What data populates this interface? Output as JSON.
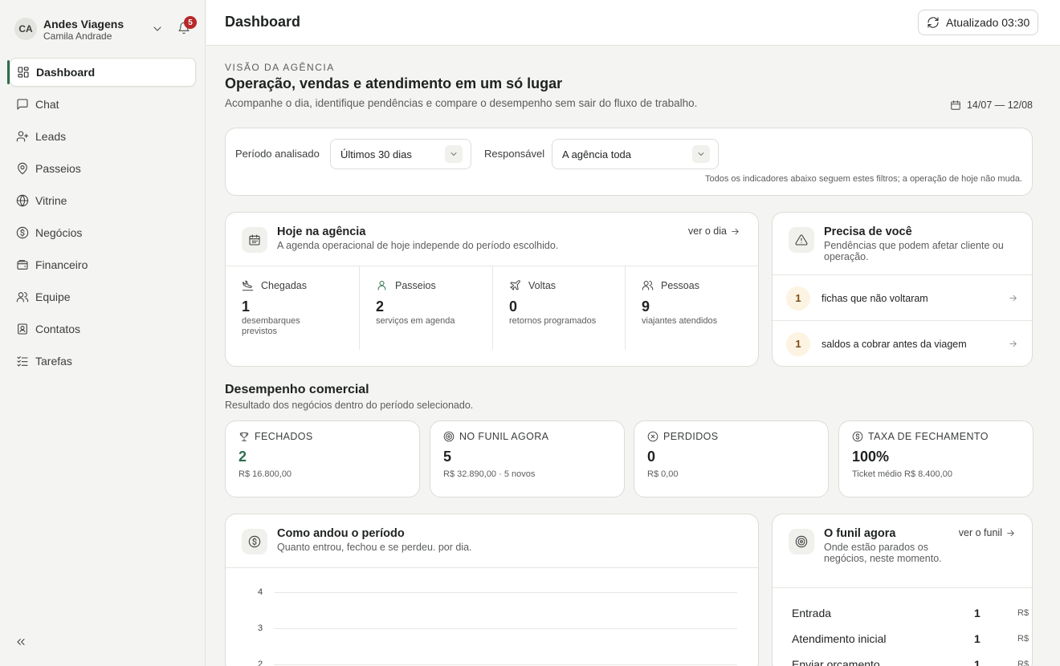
{
  "account": {
    "initials": "CA",
    "org": "Andes Viagens",
    "user": "Camila Andrade",
    "notifications": "5"
  },
  "nav": [
    {
      "label": "Dashboard",
      "icon": "dashboard-icon",
      "active": true
    },
    {
      "label": "Chat",
      "icon": "chat-icon"
    },
    {
      "label": "Leads",
      "icon": "user-plus-icon"
    },
    {
      "label": "Passeios",
      "icon": "map-pin-icon"
    },
    {
      "label": "Vitrine",
      "icon": "globe-icon"
    },
    {
      "label": "Negócios",
      "icon": "dollar-circle-icon"
    },
    {
      "label": "Financeiro",
      "icon": "wallet-icon"
    },
    {
      "label": "Equipe",
      "icon": "users-icon"
    },
    {
      "label": "Contatos",
      "icon": "contact-card-icon"
    },
    {
      "label": "Tarefas",
      "icon": "checklist-icon"
    }
  ],
  "topbar": {
    "title": "Dashboard",
    "refresh_label": "Atualizado 03:30"
  },
  "overview": {
    "eyebrow": "VISÃO DA AGÊNCIA",
    "title": "Operação, vendas e atendimento em um só lugar",
    "subtitle": "Acompanhe o dia, identifique pendências e compare o desempenho sem sair do fluxo de trabalho.",
    "date_range": "14/07 — 12/08"
  },
  "filters": {
    "period_label": "Período analisado",
    "period_value": "Últimos 30 dias",
    "owner_label": "Responsável",
    "owner_value": "A agência toda",
    "note": "Todos os indicadores abaixo seguem estes filtros; a operação de hoje não muda."
  },
  "today": {
    "title": "Hoje na agência",
    "subtitle": "A agenda operacional de hoje independe do período escolhido.",
    "link": "ver o dia",
    "stats": [
      {
        "label": "Chegadas",
        "value": "1",
        "sub": "desembarques previstos",
        "icon": "plane-landing-icon"
      },
      {
        "label": "Passeios",
        "value": "2",
        "sub": "serviços em agenda",
        "icon": "user-icon"
      },
      {
        "label": "Voltas",
        "value": "0",
        "sub": "retornos programados",
        "icon": "plane-icon"
      },
      {
        "label": "Pessoas",
        "value": "9",
        "sub": "viajantes atendidos",
        "icon": "users-icon"
      }
    ]
  },
  "attention": {
    "title": "Precisa de você",
    "subtitle": "Pendências que podem afetar cliente ou operação.",
    "items": [
      {
        "count": "1",
        "text": "fichas que não voltaram"
      },
      {
        "count": "1",
        "text": "saldos a cobrar antes da viagem"
      }
    ]
  },
  "performance": {
    "title": "Desempenho comercial",
    "subtitle": "Resultado dos negócios dentro do período selecionado.",
    "kpis": [
      {
        "label": "FECHADOS",
        "value": "2",
        "sub": "R$ 16.800,00",
        "icon": "trophy-icon",
        "color": "#2e6e4c"
      },
      {
        "label": "NO FUNIL AGORA",
        "value": "5",
        "sub": "R$ 32.890,00 · 5 novos",
        "icon": "target-icon"
      },
      {
        "label": "PERDIDOS",
        "value": "0",
        "sub": "R$ 0,00",
        "icon": "x-circle-icon"
      },
      {
        "label": "TAXA DE FECHAMENTO",
        "value": "100%",
        "sub": "Ticket médio R$ 8.400,00",
        "icon": "dollar-circle-icon"
      }
    ]
  },
  "period_chart": {
    "title": "Como andou o período",
    "subtitle": "Quanto entrou, fechou e se perdeu. por dia.",
    "y_ticks": [
      "4",
      "3",
      "2"
    ]
  },
  "funnel": {
    "title": "O funil agora",
    "subtitle": "Onde estão parados os negócios, neste momento.",
    "link": "ver o funil",
    "rows": [
      {
        "name": "Entrada",
        "count": "1",
        "money": "R$"
      },
      {
        "name": "Atendimento inicial",
        "count": "1",
        "money": "R$"
      },
      {
        "name": "Enviar orçamento",
        "count": "1",
        "money": "R$"
      }
    ]
  },
  "colors": {
    "accent": "#2e6e4c",
    "badge": "#b8282a",
    "pending": "#fdf3e2"
  }
}
